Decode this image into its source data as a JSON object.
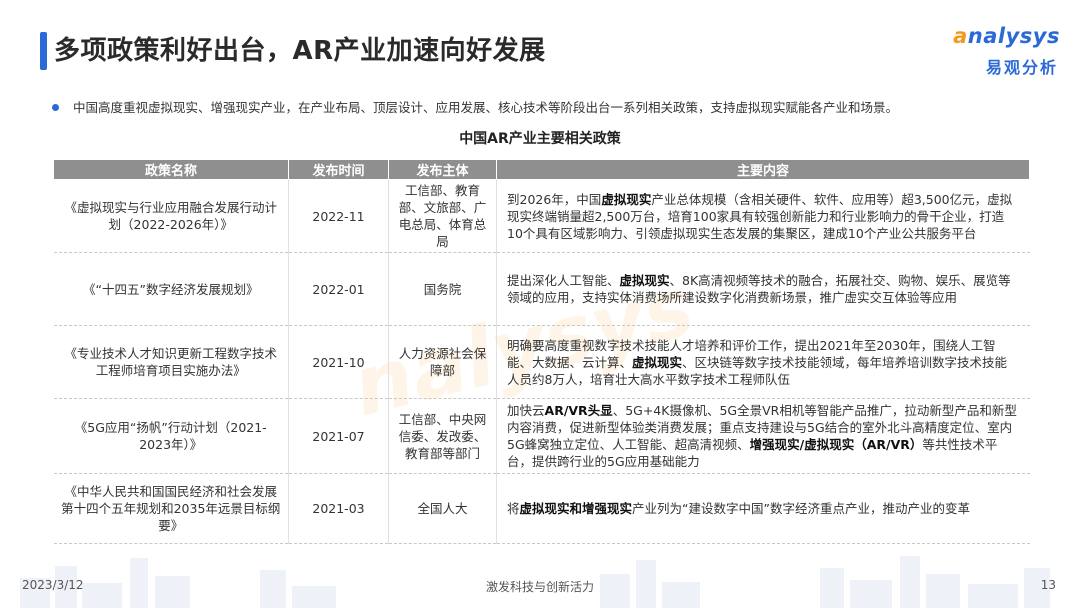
{
  "page": {
    "title": "多项政策利好出台，AR产业加速向好发展",
    "bullet": "中国高度重视虚拟现实、增强现实产业，在产业布局、顶层设计、应用发展、核心技术等阶段出台一系列相关政策，支持虚拟现实赋能各产业和场景。",
    "table_title": "中国AR产业主要相关政策"
  },
  "logo": {
    "en_first": "a",
    "en_rest": "nalysys",
    "cn": "易观分析",
    "watermark": "nalysys"
  },
  "colors": {
    "accent": "#2b6ad6",
    "logo_orange": "#f39a1e",
    "header_gray": "#8f8f8f"
  },
  "table": {
    "headers": [
      "政策名称",
      "发布时间",
      "发布主体",
      "主要内容"
    ],
    "rows": [
      {
        "name": "《虚拟现实与行业应用融合发展行动计划（2022-2026年）》",
        "date": "2022-11",
        "issuer": "工信部、教育部、文旅部、广电总局、体育总局",
        "content": [
          {
            "t": "到2026年，中国"
          },
          {
            "t": "虚拟现实",
            "b": true
          },
          {
            "t": "产业总体规模（含相关硬件、软件、应用等）超3,500亿元，虚拟现实终端销量超2,500万台，培育100家具有较强创新能力和行业影响力的骨干企业，打造10个具有区域影响力、引领虚拟现实生态发展的集聚区，建成10个产业公共服务平台"
          }
        ]
      },
      {
        "name": "《“十四五”数字经济发展规划》",
        "date": "2022-01",
        "issuer": "国务院",
        "content": [
          {
            "t": "提出深化人工智能、"
          },
          {
            "t": "虚拟现实",
            "b": true
          },
          {
            "t": "、8K高清视频等技术的融合，拓展社交、购物、娱乐、展览等领域的应用，支持实体消费场所建设数字化消费新场景，推广虚实交互体验等应用"
          }
        ]
      },
      {
        "name": "《专业技术人才知识更新工程数字技术工程师培育项目实施办法》",
        "date": "2021-10",
        "issuer": "人力资源社会保障部",
        "content": [
          {
            "t": "明确要高度重视数字技术技能人才培养和评价工作，提出2021年至2030年，围绕人工智能、大数据、云计算、"
          },
          {
            "t": "虚拟现实",
            "b": true
          },
          {
            "t": "、区块链等数字技术技能领域，每年培养培训数字技术技能人员约8万人，培育壮大高水平数字技术工程师队伍"
          }
        ]
      },
      {
        "name": "《5G应用“扬帆”行动计划（2021-2023年）》",
        "date": "2021-07",
        "issuer": "工信部、中央网信委、发改委、教育部等部门",
        "content": [
          {
            "t": "加快云"
          },
          {
            "t": "AR/VR头显",
            "b": true
          },
          {
            "t": "、5G+4K摄像机、5G全景VR相机等智能产品推广，拉动新型产品和新型内容消费，促进新型体验类消费发展；重点支持建设与5G结合的室外北斗高精度定位、室内5G蜂窝独立定位、人工智能、超高清视频、"
          },
          {
            "t": "增强现实/虚拟现实（AR/VR）",
            "b": true
          },
          {
            "t": "等共性技术平台，提供跨行业的5G应用基础能力"
          }
        ]
      },
      {
        "name": "《中华人民共和国国民经济和社会发展第十四个五年规划和2035年远景目标纲要》",
        "date": "2021-03",
        "issuer": "全国人大",
        "content": [
          {
            "t": "将"
          },
          {
            "t": "虚拟现实和增强现实",
            "b": true
          },
          {
            "t": "产业列为“建设数字中国”数字经济重点产业，推动产业的变革"
          }
        ]
      }
    ]
  },
  "footer": {
    "date": "2023/3/12",
    "slogan": "激发科技与创新活力",
    "page_number": "13"
  }
}
